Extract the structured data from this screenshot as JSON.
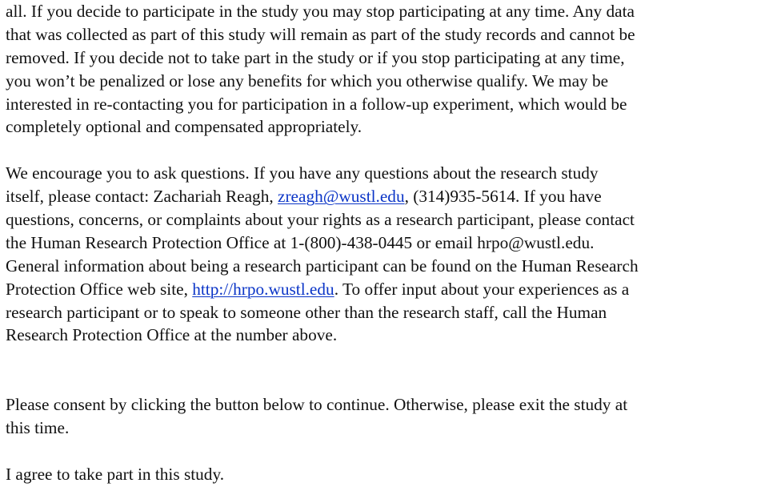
{
  "paragraph_participation": {
    "lines": [
      "all.  If you decide to participate in the study you may stop participating at any time. Any data",
      "that was collected as part of this study will remain as part of the study records and cannot be",
      "removed.  If you decide not to take part in the study or if you stop participating at any time,",
      "you won’t be penalized or lose any benefits for which you otherwise qualify.  We may be",
      "interested in re-contacting you for participation in a follow-up experiment, which would be",
      "completely optional and compensated appropriately."
    ]
  },
  "paragraph_questions": {
    "line1": "We encourage you to ask questions.  If you have any questions about the research study",
    "line2_before": "itself, please contact: Zachariah Reagh, ",
    "contact_email": "zreagh@wustl.edu",
    "line2_after": ", (314)935-5614. If you have",
    "line3": "questions, concerns, or complaints about your rights as a research participant, please contact",
    "line4": "the Human Research Protection Office at 1-(800)-438-0445 or email hrpo@wustl.edu.",
    "line5": "General information about being a research participant can be found on the Human Research",
    "line6_before": "Protection Office web site, ",
    "hrpo_url": "http://hrpo.wustl.edu",
    "line6_after": ".  To offer input about your experiences as a",
    "line7": "research participant or to speak to someone other than the research staff, call the Human",
    "line8": "Research Protection Office at the number above."
  },
  "consent_instruction": {
    "line1": "Please consent by clicking the button below to continue. Otherwise, please exit the study at",
    "line2": "this time."
  },
  "agreement_text": "I agree to take part in this study."
}
